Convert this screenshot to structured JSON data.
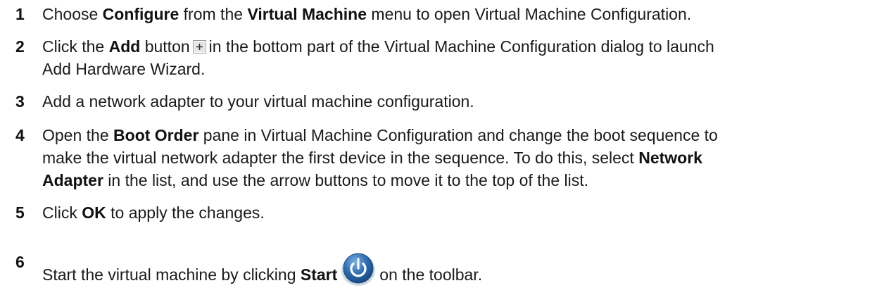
{
  "steps": [
    {
      "number": "1",
      "t1": "Choose ",
      "b1": "Configure",
      "t2": " from the ",
      "b2": "Virtual Machine",
      "t3": " menu to open Virtual Machine Configuration."
    },
    {
      "number": "2",
      "t1": "Click the ",
      "b1": "Add",
      "t2": " button",
      "icon": "add-plus-icon",
      "t3": "in the bottom part of the Virtual Machine Configuration dialog to launch",
      "t4": "Add Hardware Wizard."
    },
    {
      "number": "3",
      "t1": "Add a network adapter to your virtual machine configuration."
    },
    {
      "number": "4",
      "t1": "Open the ",
      "b1": "Boot Order",
      "t2": " pane in Virtual Machine Configuration and change the boot sequence to",
      "t3": "make the virtual network adapter the first device in the sequence. To do this, select ",
      "b2": "Network",
      "b3": "Adapter",
      "t4": " in the list, and use the arrow buttons to move it to the top of the list."
    },
    {
      "number": "5",
      "t1": "Click ",
      "b1": "OK",
      "t2": " to apply the changes."
    },
    {
      "number": "6",
      "t1": "Start the virtual machine by clicking ",
      "b1": "Start",
      "icon": "power-start-icon",
      "t2": "on the toolbar."
    }
  ],
  "colors": {
    "text": "#1a1a1a",
    "start_icon_blue": "#2f6db0",
    "add_icon_bg": "#e6e6e6"
  }
}
